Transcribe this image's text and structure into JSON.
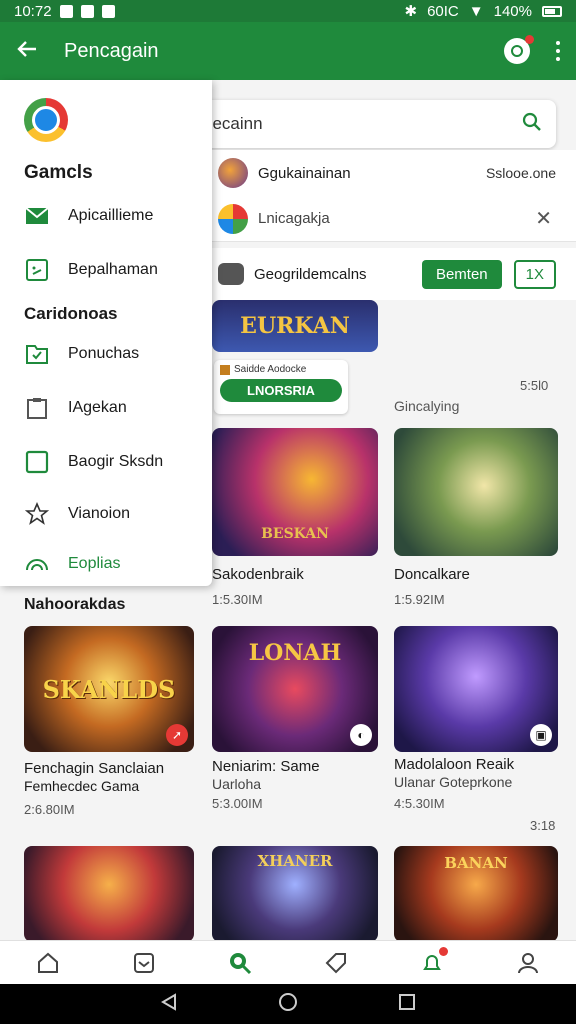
{
  "status_bar": {
    "time": "10:72",
    "battery_text": "60IC",
    "percent": "140%"
  },
  "app_bar": {
    "title": "Pencagain"
  },
  "search": {
    "placeholder": "Qocaiain Nonnecainn"
  },
  "suggestions": [
    {
      "label": "Ggukainainan",
      "meta": "Sslooe.one"
    },
    {
      "label": "Lnicagakja"
    },
    {
      "label": "Geogrildemcalns",
      "primary": "Bemten",
      "secondary": "1X"
    }
  ],
  "tag_card": {
    "line": "Saidde Aodocke",
    "button": "LNORSRIA"
  },
  "top_banner": {
    "title": "EURKAN"
  },
  "drawer": {
    "section1": "Gamcls",
    "items1": [
      {
        "label": "Apicaillieme",
        "icon": "mail-icon"
      },
      {
        "label": "Bepalhaman",
        "icon": "tablet-icon"
      }
    ],
    "section2": "Caridonoas",
    "items2": [
      {
        "label": "Ponuchas",
        "icon": "folder-icon"
      },
      {
        "label": "IAgekan",
        "icon": "clipboard-icon"
      },
      {
        "label": "Baogir Sksdn",
        "icon": "device-icon"
      },
      {
        "label": "Vianoion",
        "icon": "star-icon"
      },
      {
        "label": "Eoplias",
        "icon": "rainbow-icon"
      }
    ]
  },
  "section_label": "Nahoorakdas",
  "misc": {
    "gonc": "Gincalying",
    "count1": "5:5l0",
    "count2": "3:18"
  },
  "row1": [
    {
      "title": "Sakodenbraik",
      "sub": "1:5.30IM"
    },
    {
      "title": "Doncalkare",
      "sub": "1:5.92IM"
    }
  ],
  "row2": [
    {
      "title": "Fenchagin Sanclaian",
      "title2": "Femhecdec Gama",
      "sub": "2:6.80IM",
      "art": "SKANLDS"
    },
    {
      "title": "Neniarim: Same",
      "title2": "Uarloha",
      "sub": "5:3.00IM",
      "art": "LONAH"
    },
    {
      "title": "Madolaloon Reaik",
      "title2": "Ulanar Goteprkone",
      "sub": "4:5.30IM"
    }
  ],
  "row3": [
    {
      "art": ""
    },
    {
      "art": "XHANER"
    },
    {
      "art": "BANAN"
    }
  ],
  "row1_art": "BESKAN",
  "colors": {
    "primary": "#1f8a3c",
    "status_bar": "#1e7a37",
    "badge_red": "#e53935"
  }
}
